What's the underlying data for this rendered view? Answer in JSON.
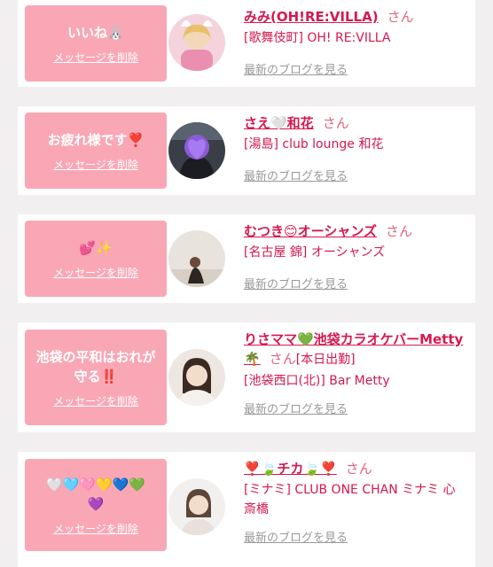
{
  "cards": [
    {
      "message": "いいね🐰",
      "delete_label": "メッセージを削除",
      "name": "みみ(OH!RE:VILLA)",
      "honorific": "さん",
      "shop": "[歌舞伎町] OH! RE:VILLA",
      "blog_label": "最新のブログを見る"
    },
    {
      "message": "お疲れ様です❣️",
      "delete_label": "メッセージを削除",
      "name": "さえ🤍和花",
      "honorific": "さん",
      "shop": "[湯島] club lounge 和花",
      "blog_label": "最新のブログを見る"
    },
    {
      "message": "💕✨",
      "delete_label": "メッセージを削除",
      "name": "むつき😊オーシャンズ",
      "honorific": "さん",
      "shop": "[名古屋 錦] オーシャンズ",
      "blog_label": "最新のブログを見る"
    },
    {
      "message": "池袋の平和はおれが守る‼️",
      "delete_label": "メッセージを削除",
      "name": "りさママ💚池袋カラオケバーMetty🌴",
      "honorific": "さん",
      "shop_prefix": "[本日出勤]",
      "shop": "[池袋西口(北)] Bar Metty",
      "blog_label": "最新のブログを見る"
    },
    {
      "message": "🤍🩵🩷💛💙💚💜",
      "delete_label": "メッセージを削除",
      "name": "❣️🍃チカ🍃❣️",
      "honorific": "さん",
      "shop": "[ミナミ] CLUB ONE CHAN ミナミ 心斎橋",
      "blog_label": "最新のブログを見る"
    }
  ]
}
